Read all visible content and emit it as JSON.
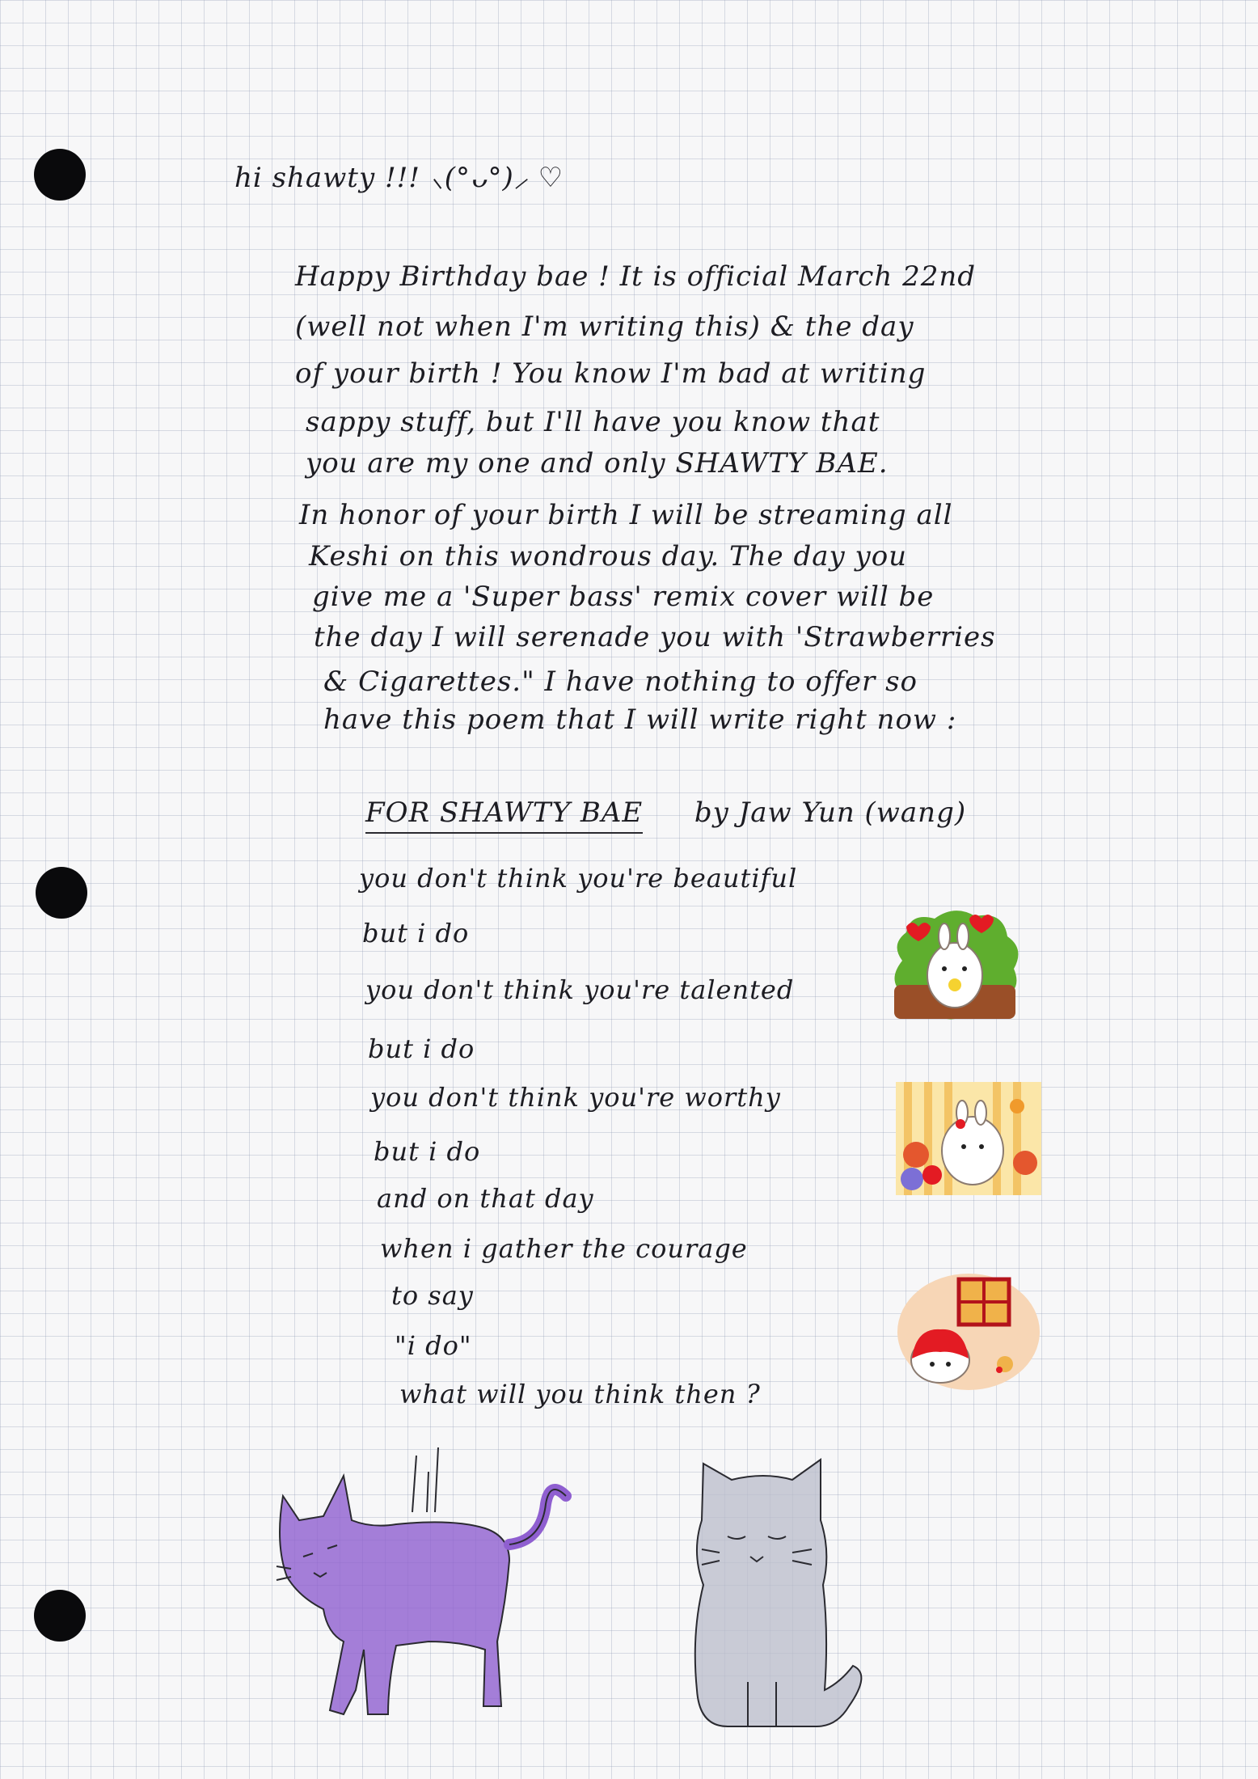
{
  "greeting": "hi shawty !!! ⸜(°ᴗ°)⸝ ♡",
  "letter": [
    "Happy Birthday bae ! It is official March 22nd",
    "(well not when I'm writing this) & the day",
    "of your birth ! You know I'm bad at writing",
    "sappy stuff, but I'll have you know that",
    "you are my one and only SHAWTY BAE.",
    "In honor of your birth I will be streaming all",
    "Keshi on this wondrous day. The day you",
    "give me a 'Super bass' remix cover will be",
    "the day I will serenade you with 'Strawberries",
    "& Cigarettes.\" I have nothing to offer so",
    "have this poem that I will write right now :"
  ],
  "poem": {
    "title": "FOR SHAWTY BAE",
    "byline": "by Jaw Yun (wang)",
    "lines": [
      "you don't think you're beautiful",
      "but i do",
      "you don't think you're talented",
      "but i do",
      "you don't think you're worthy",
      "but i do",
      "and on that day",
      "when i gather the courage",
      "to say",
      "\"i do\"",
      "what will you think then ?"
    ]
  },
  "colors": {
    "ink": "#1c1c22",
    "grid": "#a3aabd",
    "purple_cat": "#8f5fd0",
    "grey_cat": "#b9bccb",
    "sticker_green": "#5fae2e",
    "heart_red": "#e31b23"
  },
  "stickers": [
    "bunny-hearts-sticker",
    "bunny-flowers-sticker",
    "bunny-window-sticker"
  ]
}
